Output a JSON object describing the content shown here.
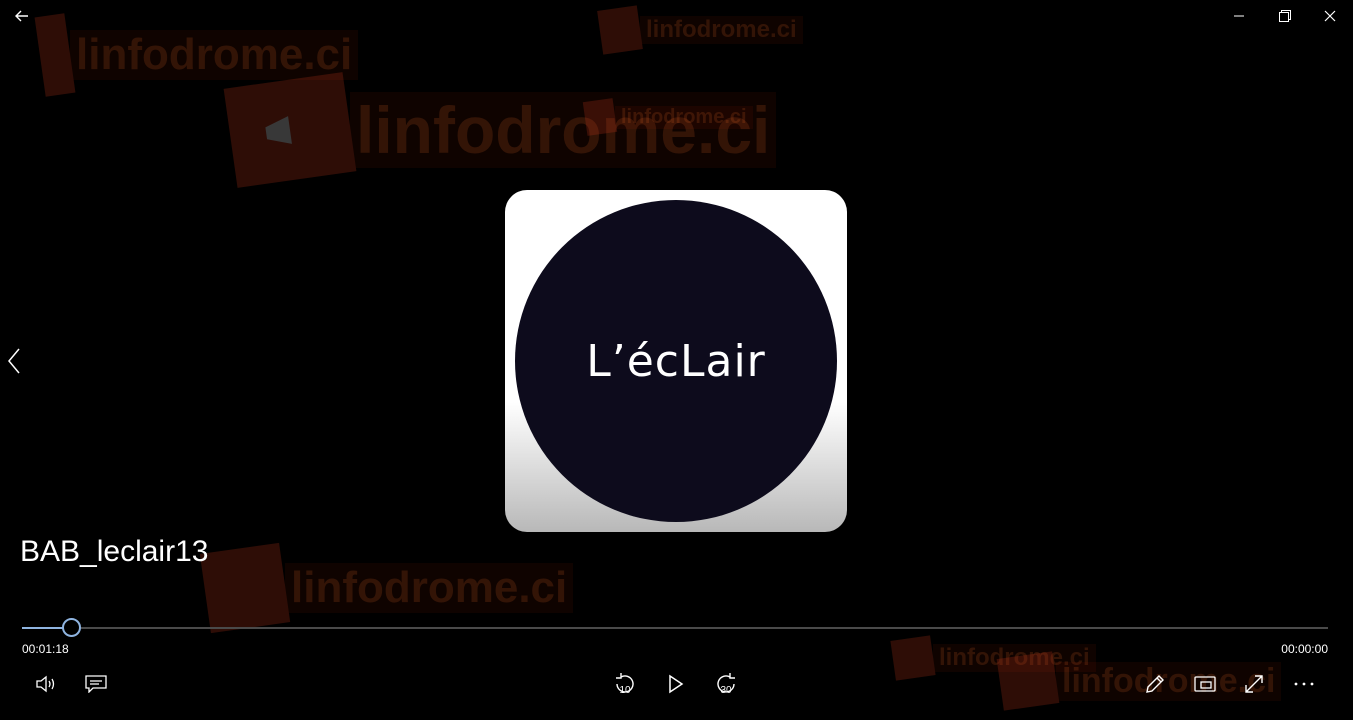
{
  "window": {
    "back_icon": "back-arrow-icon",
    "minimize_icon": "minimize-icon",
    "maximize_icon": "restore-icon",
    "close_icon": "close-icon"
  },
  "watermark": {
    "text": "linfodrome.ci"
  },
  "album_art": {
    "text": "L’écLair",
    "disc_color": "#0d0b1c"
  },
  "media": {
    "title": "BAB_leclair13",
    "elapsed": "00:01:18",
    "remaining": "00:00:00",
    "progress": 0.037,
    "accent": "#8fb4e0"
  },
  "controls": {
    "volume_icon": "volume-icon",
    "subtitles_icon": "subtitles-icon",
    "skip_back_label": "10",
    "play_icon": "play-icon",
    "skip_forward_label": "30",
    "edit_icon": "pencil-icon",
    "mini_view_icon": "mini-view-icon",
    "fullscreen_icon": "fullscreen-icon",
    "more_icon": "more-icon"
  }
}
